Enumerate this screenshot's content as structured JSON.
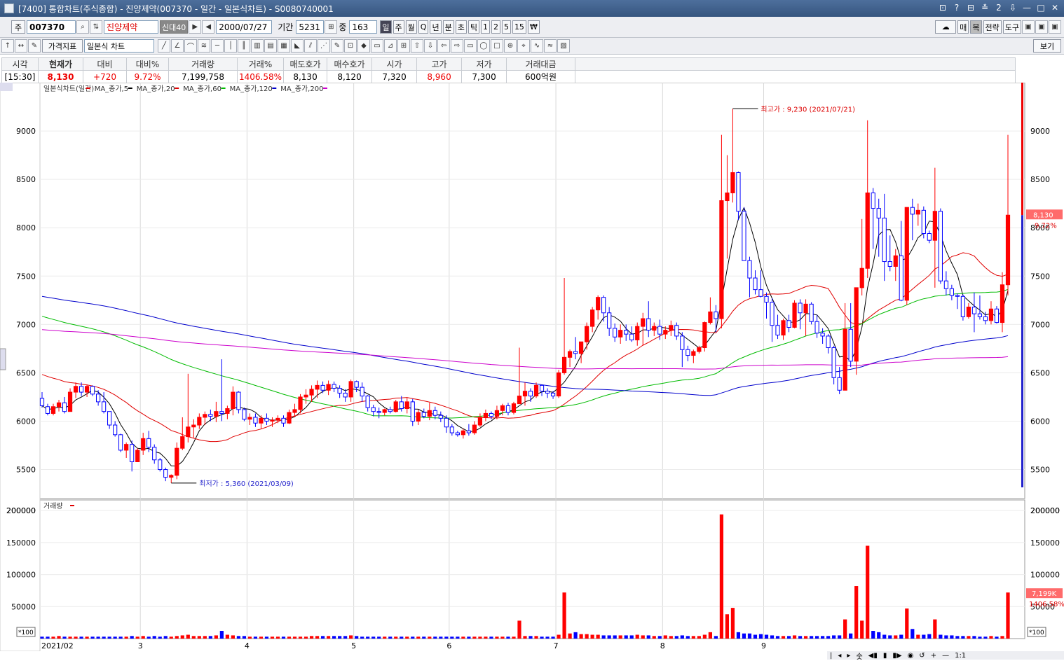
{
  "window": {
    "title": "[7400] 통합차트(주식종합) - 진양제약(007370 - 일간 - 일본식차트) - S0080740001",
    "buttons": [
      "⊡",
      "?",
      "⊟",
      "≛",
      "2",
      "⇩",
      "—",
      "□",
      "✕"
    ]
  },
  "toolbar1": {
    "market": "주",
    "code": "007370",
    "name": "진양제약",
    "tags": "신대40",
    "date": "2000/07/27",
    "period_label": "기간",
    "period_value": "5231",
    "count_label": "중",
    "count_value": "163",
    "periods": [
      "일",
      "주",
      "월",
      "Q",
      "년",
      "분",
      "초",
      "틱",
      "1",
      "2",
      "5",
      "15",
      "₩"
    ],
    "right": [
      "☁",
      "매",
      "복",
      "전략",
      "도구",
      "▣",
      "▣",
      "▣"
    ]
  },
  "toolbar2": {
    "price_indicator": "가격지표",
    "chart_type": "일본식 차트",
    "view": "보기"
  },
  "info": {
    "headers": [
      "시각",
      "현재가",
      "대비",
      "대비%",
      "거래량",
      "거래%",
      "매도호가",
      "매수호가",
      "시가",
      "고가",
      "저가",
      "거래대금"
    ],
    "values": [
      "[15:30]",
      "8,130",
      "+720",
      "9.72%",
      "7,199,758",
      "1406.58%",
      "8,130",
      "8,120",
      "7,320",
      "8,960",
      "7,300",
      "600억원"
    ]
  },
  "legend": {
    "price": [
      {
        "text": "일본식차트(일간)",
        "color": "#e00000"
      },
      {
        "text": "MA_종가,5",
        "color": "#000000"
      },
      {
        "text": "MA_종가,20",
        "color": "#e00000"
      },
      {
        "text": "MA_종가,60",
        "color": "#00bb00"
      },
      {
        "text": "MA_종가,120",
        "color": "#0000cc"
      },
      {
        "text": "MA_종가,200",
        "color": "#cc00cc"
      }
    ],
    "volume": {
      "text": "거래량",
      "color": "#e00000"
    }
  },
  "annotations": {
    "high": "최고가 : 9,230 (2021/07/21)",
    "low": "최저가 : 5,360 (2021/03/09)"
  },
  "side_labels": {
    "price": "8,130",
    "pct": "9.72%",
    "vol": "7,199K",
    "volpct": "1406.58%",
    "unit": "*100"
  },
  "bottom": [
    "|",
    "◂",
    "▸",
    "숫",
    "◀▮",
    "▮",
    "▮▶",
    "◉",
    "↺",
    "+",
    "—",
    "1:1"
  ],
  "chart_data": {
    "type": "candlestick",
    "x_labels": [
      "2021/02",
      "3",
      "4",
      "5",
      "6",
      "7",
      "8",
      "9"
    ],
    "price_ticks": [
      5500,
      6000,
      6500,
      7000,
      7500,
      8000,
      8500,
      9000
    ],
    "volume_ticks": [
      50000,
      100000,
      150000,
      200000
    ],
    "price_range": [
      5200,
      9500
    ],
    "volume_range": [
      0,
      210000
    ],
    "last_close": 8130,
    "month_starts": [
      0,
      18,
      37,
      56,
      73,
      92,
      111,
      129
    ],
    "candles": [
      [
        6236,
        6300,
        6140,
        6160,
        3
      ],
      [
        6150,
        6180,
        6060,
        6080,
        3
      ],
      [
        6080,
        6180,
        6060,
        6150,
        3
      ],
      [
        6150,
        6220,
        6100,
        6190,
        4
      ],
      [
        6190,
        6250,
        6080,
        6100,
        3
      ],
      [
        6100,
        6340,
        6100,
        6300,
        3
      ],
      [
        6300,
        6400,
        6240,
        6360,
        3
      ],
      [
        6360,
        6400,
        6260,
        6300,
        3
      ],
      [
        6300,
        6380,
        6250,
        6360,
        3
      ],
      [
        6360,
        6370,
        6260,
        6280,
        3
      ],
      [
        6280,
        6320,
        6160,
        6200,
        3
      ],
      [
        6200,
        6300,
        6080,
        6100,
        3
      ],
      [
        6100,
        6100,
        5920,
        5960,
        3
      ],
      [
        5960,
        6000,
        5840,
        5860,
        3
      ],
      [
        5860,
        5870,
        5680,
        5700,
        3
      ],
      [
        5700,
        5780,
        5620,
        5760,
        3
      ],
      [
        5760,
        5800,
        5480,
        5580,
        4
      ],
      [
        5580,
        5720,
        5600,
        5700,
        3
      ],
      [
        5700,
        5880,
        5650,
        5820,
        4
      ],
      [
        5820,
        5900,
        5680,
        5730,
        3
      ],
      [
        5730,
        5760,
        5560,
        5600,
        4
      ],
      [
        5600,
        5620,
        5480,
        5500,
        3
      ],
      [
        5500,
        5520,
        5380,
        5420,
        4
      ],
      [
        5420,
        5450,
        5360,
        5440,
        3
      ],
      [
        5440,
        5780,
        5400,
        5720,
        4
      ],
      [
        5720,
        6040,
        5700,
        5840,
        5
      ],
      [
        5840,
        6490,
        5780,
        5940,
        6
      ],
      [
        5940,
        6020,
        5830,
        5960,
        4
      ],
      [
        5960,
        6080,
        5920,
        6040,
        4
      ],
      [
        6040,
        6100,
        5960,
        6070,
        4
      ],
      [
        6070,
        6120,
        6000,
        6050,
        4
      ],
      [
        6050,
        6200,
        5990,
        6100,
        5
      ],
      [
        6100,
        6640,
        6000,
        6080,
        12
      ],
      [
        6080,
        6160,
        6020,
        6130,
        6
      ],
      [
        6130,
        6360,
        6060,
        6300,
        5
      ],
      [
        6300,
        6310,
        6080,
        6120,
        4
      ],
      [
        6120,
        6140,
        6000,
        6020,
        4
      ],
      [
        6020,
        6080,
        5960,
        6040,
        3
      ],
      [
        6040,
        6080,
        5940,
        5980,
        3
      ],
      [
        5980,
        6060,
        5920,
        6030,
        3
      ],
      [
        6030,
        6080,
        5960,
        6000,
        3
      ],
      [
        6000,
        6040,
        5940,
        6010,
        3
      ],
      [
        6010,
        6060,
        5980,
        6030,
        3
      ],
      [
        6030,
        6060,
        5940,
        5980,
        3
      ],
      [
        5980,
        6120,
        5970,
        6090,
        3
      ],
      [
        6090,
        6180,
        6040,
        6120,
        3
      ],
      [
        6120,
        6280,
        6080,
        6250,
        3
      ],
      [
        6250,
        6330,
        6180,
        6270,
        3
      ],
      [
        6270,
        6370,
        6200,
        6330,
        4
      ],
      [
        6330,
        6420,
        6240,
        6370,
        4
      ],
      [
        6370,
        6410,
        6290,
        6320,
        4
      ],
      [
        6320,
        6420,
        6270,
        6380,
        4
      ],
      [
        6380,
        6410,
        6300,
        6340,
        4
      ],
      [
        6340,
        6370,
        6240,
        6290,
        4
      ],
      [
        6290,
        6330,
        6200,
        6250,
        4
      ],
      [
        6250,
        6430,
        6200,
        6410,
        5
      ],
      [
        6410,
        6420,
        6300,
        6350,
        4
      ],
      [
        6350,
        6400,
        6200,
        6260,
        3
      ],
      [
        6260,
        6270,
        6100,
        6140,
        3
      ],
      [
        6140,
        6170,
        6050,
        6100,
        3
      ],
      [
        6100,
        6140,
        6030,
        6090,
        3
      ],
      [
        6090,
        6130,
        6060,
        6120,
        3
      ],
      [
        6120,
        6150,
        6080,
        6100,
        3
      ],
      [
        6100,
        6220,
        6090,
        6200,
        3
      ],
      [
        6200,
        6260,
        6100,
        6130,
        3
      ],
      [
        6130,
        6240,
        6080,
        6200,
        3
      ],
      [
        6200,
        6230,
        5950,
        6000,
        3
      ],
      [
        6000,
        6120,
        5960,
        6090,
        3
      ],
      [
        6090,
        6130,
        6030,
        6050,
        3
      ],
      [
        6050,
        6190,
        6010,
        6110,
        3
      ],
      [
        6110,
        6150,
        6020,
        6060,
        3
      ],
      [
        6060,
        6100,
        5990,
        6030,
        3
      ],
      [
        6030,
        6060,
        5880,
        5940,
        3
      ],
      [
        5940,
        5970,
        5850,
        5880,
        3
      ],
      [
        5880,
        5900,
        5840,
        5860,
        3
      ],
      [
        5860,
        5920,
        5820,
        5900,
        3
      ],
      [
        5900,
        5970,
        5850,
        5880,
        3
      ],
      [
        5880,
        6000,
        5860,
        5960,
        3
      ],
      [
        5960,
        6080,
        5940,
        6040,
        3
      ],
      [
        6040,
        6120,
        6000,
        6080,
        3
      ],
      [
        6080,
        6100,
        6020,
        6050,
        3
      ],
      [
        6050,
        6160,
        6020,
        6110,
        3
      ],
      [
        6110,
        6180,
        6060,
        6160,
        3
      ],
      [
        6160,
        6190,
        6060,
        6090,
        3
      ],
      [
        6090,
        6200,
        6070,
        6180,
        3
      ],
      [
        6180,
        6760,
        6180,
        6260,
        28
      ],
      [
        6260,
        6400,
        6160,
        6310,
        4
      ],
      [
        6310,
        6340,
        6200,
        6260,
        4
      ],
      [
        6260,
        6400,
        6240,
        6370,
        4
      ],
      [
        6370,
        6350,
        6260,
        6310,
        3
      ],
      [
        6310,
        6340,
        6240,
        6290,
        3
      ],
      [
        6290,
        6310,
        6230,
        6260,
        3
      ],
      [
        6260,
        6530,
        6240,
        6500,
        6
      ],
      [
        6500,
        7480,
        6480,
        6660,
        72
      ],
      [
        6660,
        6740,
        6560,
        6720,
        8
      ],
      [
        6720,
        6870,
        6640,
        6700,
        10
      ],
      [
        6700,
        6780,
        6600,
        6820,
        7
      ],
      [
        6820,
        7020,
        6740,
        6980,
        7
      ],
      [
        6980,
        7180,
        6920,
        7150,
        6
      ],
      [
        7150,
        7300,
        7050,
        7280,
        6
      ],
      [
        7280,
        7300,
        7030,
        7120,
        5
      ],
      [
        7120,
        7180,
        6880,
        6960,
        5
      ],
      [
        6960,
        7010,
        6820,
        6870,
        5
      ],
      [
        6870,
        7000,
        6800,
        6940,
        5
      ],
      [
        6940,
        7000,
        6830,
        6900,
        5
      ],
      [
        6900,
        6980,
        6820,
        6840,
        5
      ],
      [
        6840,
        7020,
        6780,
        6980,
        6
      ],
      [
        6980,
        7120,
        6780,
        7060,
        5
      ],
      [
        7060,
        7240,
        6870,
        6940,
        5
      ],
      [
        6940,
        7020,
        6880,
        6980,
        4
      ],
      [
        6980,
        7050,
        6840,
        6900,
        4
      ],
      [
        6900,
        6980,
        6850,
        6940,
        5
      ],
      [
        6940,
        7040,
        6880,
        6990,
        4
      ],
      [
        6990,
        7020,
        6840,
        6880,
        4
      ],
      [
        6880,
        6920,
        6560,
        6740,
        5
      ],
      [
        6740,
        6780,
        6620,
        6680,
        4
      ],
      [
        6680,
        6740,
        6600,
        6720,
        4
      ],
      [
        6720,
        6780,
        6700,
        6760,
        4
      ],
      [
        6760,
        7030,
        6720,
        7020,
        6
      ],
      [
        7020,
        7280,
        7000,
        7130,
        10
      ],
      [
        7130,
        7200,
        6920,
        7060,
        4
      ],
      [
        7060,
        8960,
        6960,
        8280,
        194
      ],
      [
        8280,
        8750,
        7680,
        8360,
        38
      ],
      [
        8360,
        9230,
        8260,
        8570,
        48
      ],
      [
        8570,
        8580,
        8080,
        8170,
        10
      ],
      [
        8170,
        8210,
        7800,
        7660,
        8
      ],
      [
        7660,
        7700,
        7280,
        7480,
        8
      ],
      [
        7480,
        7560,
        7310,
        7360,
        6
      ],
      [
        7360,
        7560,
        7280,
        7290,
        7
      ],
      [
        7290,
        7330,
        7060,
        7230,
        6
      ],
      [
        7230,
        7270,
        6820,
        6990,
        5
      ],
      [
        6990,
        7100,
        6850,
        6890,
        4
      ],
      [
        6890,
        7060,
        6840,
        7040,
        4
      ],
      [
        7040,
        7100,
        6920,
        6970,
        4
      ],
      [
        6970,
        7250,
        6960,
        7220,
        5
      ],
      [
        7220,
        7260,
        6950,
        7120,
        4
      ],
      [
        7120,
        7260,
        6880,
        7210,
        4
      ],
      [
        7210,
        7230,
        7000,
        7030,
        4
      ],
      [
        7030,
        7100,
        6860,
        6910,
        4
      ],
      [
        6910,
        6960,
        6800,
        6880,
        4
      ],
      [
        6880,
        6900,
        6700,
        6760,
        4
      ],
      [
        6760,
        6780,
        6380,
        6450,
        5
      ],
      [
        6450,
        6560,
        6280,
        6320,
        5
      ],
      [
        6320,
        7220,
        6330,
        6950,
        30
      ],
      [
        6950,
        7220,
        6560,
        6620,
        8
      ],
      [
        6620,
        7050,
        6480,
        7380,
        82
      ],
      [
        7380,
        8090,
        7300,
        7580,
        28
      ],
      [
        7580,
        9110,
        7480,
        8360,
        145
      ],
      [
        8360,
        8410,
        7780,
        8200,
        12
      ],
      [
        8200,
        8300,
        7700,
        8100,
        10
      ],
      [
        8100,
        8350,
        7450,
        7650,
        6
      ],
      [
        7650,
        7920,
        7550,
        7600,
        5
      ],
      [
        7600,
        7780,
        7450,
        7710,
        5
      ],
      [
        7710,
        8070,
        7240,
        7250,
        6
      ],
      [
        7250,
        7450,
        7200,
        8210,
        47
      ],
      [
        8210,
        8300,
        7870,
        8140,
        15
      ],
      [
        8140,
        8250,
        8020,
        8180,
        6
      ],
      [
        8180,
        8220,
        7890,
        7940,
        6
      ],
      [
        7940,
        7970,
        7840,
        7870,
        7
      ],
      [
        7870,
        8620,
        7380,
        8170,
        30
      ],
      [
        8170,
        8200,
        7420,
        7450,
        6
      ],
      [
        7450,
        7550,
        7300,
        7370,
        5
      ],
      [
        7370,
        7410,
        7250,
        7300,
        5
      ],
      [
        7300,
        7320,
        7160,
        7290,
        4
      ],
      [
        7290,
        7310,
        7040,
        7080,
        4
      ],
      [
        7080,
        7220,
        7060,
        7180,
        4
      ],
      [
        7180,
        7330,
        6920,
        7110,
        4
      ],
      [
        7110,
        7300,
        7050,
        7080,
        3
      ],
      [
        7080,
        7130,
        7000,
        7040,
        3
      ],
      [
        7040,
        7240,
        7000,
        7160,
        4
      ],
      [
        7160,
        7190,
        7010,
        7020,
        3
      ],
      [
        7020,
        7540,
        6920,
        7410,
        4
      ],
      [
        7410,
        8960,
        7300,
        8130,
        72
      ]
    ],
    "ma5_color": "#000000",
    "ma20_color": "#e00000",
    "ma60_color": "#00bb00",
    "ma120_color": "#0000cc",
    "ma200_color": "#cc00cc",
    "up_color": "#ff0000",
    "down_color": "#0000ff"
  }
}
